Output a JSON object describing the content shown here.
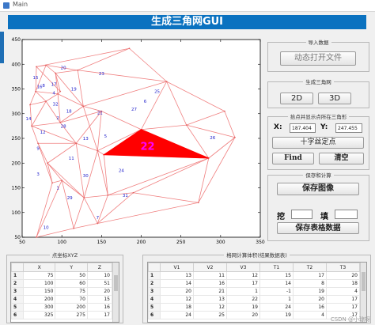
{
  "window": {
    "title": "Main"
  },
  "banner": {
    "title": "生成三角网GUI"
  },
  "chart_data": {
    "type": "scatter",
    "subtype": "triangulation-mesh",
    "xlim": [
      50,
      350
    ],
    "ylim": [
      50,
      450
    ],
    "xticks": [
      "50",
      "100",
      "150",
      "200",
      "250",
      "300",
      "350"
    ],
    "yticks": [
      "50",
      "100",
      "150",
      "200",
      "250",
      "300",
      "350",
      "400",
      "450"
    ],
    "highlight": {
      "label": "22",
      "color": "#ff0000"
    },
    "triangle_labels": [
      "1",
      "2",
      "3",
      "4",
      "5",
      "6",
      "7",
      "8",
      "9",
      "10",
      "11",
      "12",
      "13",
      "14",
      "15",
      "16",
      "17",
      "18",
      "19",
      "20",
      "21",
      "22",
      "23",
      "24",
      "25",
      "26",
      "27",
      "28",
      "29",
      "30",
      "31",
      "32"
    ],
    "grid": false
  },
  "import": {
    "title": "导入数据",
    "open_button": "动态打开文件"
  },
  "generate": {
    "title": "生成三角网",
    "btn_2d": "2D",
    "btn_3d": "3D"
  },
  "locate": {
    "title": "拾点并显示点所在三角形",
    "x_label": "X:",
    "x_value": "187.404",
    "y_label": "Y:",
    "y_value": "247.455",
    "crosshair_button": "十字丝定点",
    "find_button": "Find",
    "clear_button": "清空"
  },
  "save": {
    "title": "保存和计算",
    "save_image_button": "保存图像",
    "dig_label": "挖",
    "dig_value": "",
    "fill_label": "填",
    "fill_value": "",
    "save_table_button": "保存表格数据"
  },
  "points_table": {
    "title": "点坐标XYZ",
    "columns": [
      "X",
      "Y",
      "Z"
    ],
    "rows": [
      {
        "id": "1",
        "x": "75",
        "y": "50",
        "z": "10"
      },
      {
        "id": "2",
        "x": "100",
        "y": "60",
        "z": "51"
      },
      {
        "id": "3",
        "x": "150",
        "y": "75",
        "z": "20"
      },
      {
        "id": "4",
        "x": "200",
        "y": "70",
        "z": "15"
      },
      {
        "id": "5",
        "x": "300",
        "y": "200",
        "z": "16"
      },
      {
        "id": "6",
        "x": "325",
        "y": "275",
        "z": "17"
      }
    ]
  },
  "tri_table": {
    "title": "格网计算体积(结果数据表)",
    "columns": [
      "V1",
      "V2",
      "V3",
      "T1",
      "T2",
      "T3"
    ],
    "rows": [
      {
        "id": "1",
        "c": [
          "13",
          "11",
          "12",
          "15",
          "17",
          "20"
        ]
      },
      {
        "id": "2",
        "c": [
          "14",
          "16",
          "17",
          "14",
          "8",
          "18"
        ]
      },
      {
        "id": "3",
        "c": [
          "20",
          "21",
          "1",
          "-1",
          "19",
          "4"
        ]
      },
      {
        "id": "4",
        "c": [
          "12",
          "13",
          "22",
          "1",
          "20",
          "17"
        ]
      },
      {
        "id": "5",
        "c": [
          "18",
          "12",
          "19",
          "24",
          "16",
          "17"
        ]
      },
      {
        "id": "6",
        "c": [
          "24",
          "25",
          "20",
          "19",
          "4",
          "17"
        ]
      }
    ]
  },
  "watermark": "CSDN @小琼呀"
}
